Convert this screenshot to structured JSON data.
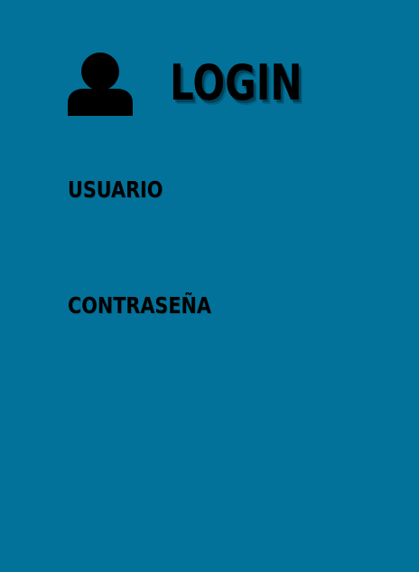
{
  "screen": {
    "title": "LOGIN",
    "fields": {
      "username_label": "USUARIO",
      "password_label": "CONTRASEÑA"
    },
    "icon": "user-icon",
    "colors": {
      "background": "#03729a",
      "text": "#000000"
    }
  }
}
